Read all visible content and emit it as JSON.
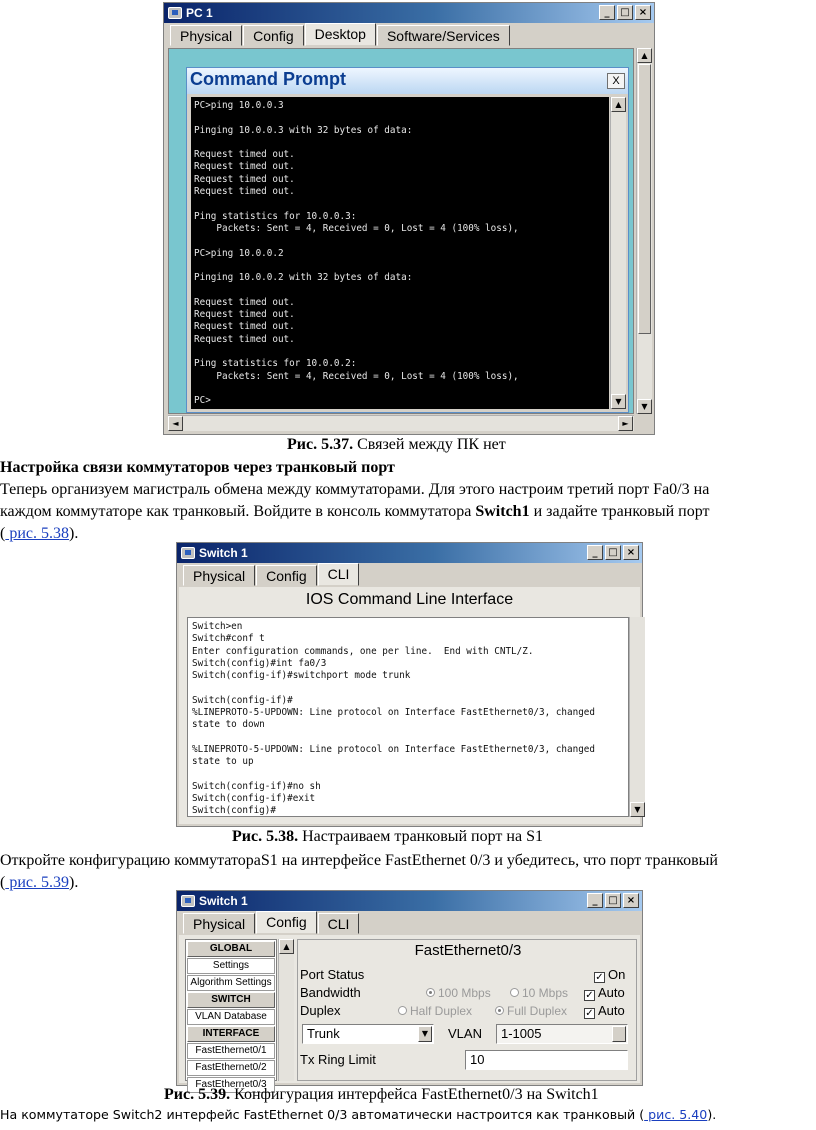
{
  "fig1": {
    "window_title": "PC 1",
    "tabs": [
      "Physical",
      "Config",
      "Desktop",
      "Software/Services"
    ],
    "active_tab": 2,
    "cmd_title": "Command Prompt",
    "cmd_close": "X",
    "console_lines": [
      "PC>ping 10.0.0.3",
      "",
      "Pinging 10.0.0.3 with 32 bytes of data:",
      "",
      "Request timed out.",
      "Request timed out.",
      "Request timed out.",
      "Request timed out.",
      "",
      "Ping statistics for 10.0.0.3:",
      "    Packets: Sent = 4, Received = 0, Lost = 4 (100% loss),",
      "",
      "PC>ping 10.0.0.2",
      "",
      "Pinging 10.0.0.2 with 32 bytes of data:",
      "",
      "Request timed out.",
      "Request timed out.",
      "Request timed out.",
      "Request timed out.",
      "",
      "Ping statistics for 10.0.0.2:",
      "    Packets: Sent = 4, Received = 0, Lost = 4 (100% loss),",
      "",
      "PC>"
    ],
    "caption_num": "Рис. 5.37.",
    "caption_text": " Связей между ПК нет"
  },
  "section": {
    "heading": "Настройка связи коммутаторов через транковый порт",
    "p1_line1": "Теперь организуем магистраль обмена между коммутаторами. Для этого настроим третий порт Fa0/3 на",
    "p1_line2_a": "каждом коммутаторе как транковый. Войдите в консоль коммутатора ",
    "p1_line2_bold": "Switch1",
    "p1_line2_b": " и задайте транковый порт",
    "p1_line3_open": "(",
    "p1_line3_link": " рис. 5.38",
    "p1_line3_close": ")."
  },
  "fig2": {
    "window_title": "Switch 1",
    "tabs": [
      "Physical",
      "Config",
      "CLI"
    ],
    "active_tab": 2,
    "header": "IOS Command Line Interface",
    "cli_lines": [
      "Switch>en",
      "Switch#conf t",
      "Enter configuration commands, one per line.  End with CNTL/Z.",
      "Switch(config)#int fa0/3",
      "Switch(config-if)#switchport mode trunk",
      "",
      "Switch(config-if)#",
      "%LINEPROTO-5-UPDOWN: Line protocol on Interface FastEthernet0/3, changed",
      "state to down",
      "",
      "%LINEPROTO-5-UPDOWN: Line protocol on Interface FastEthernet0/3, changed",
      "state to up",
      "",
      "Switch(config-if)#no sh",
      "Switch(config-if)#exit",
      "Switch(config)#"
    ],
    "caption_num": "Рис. 5.38.",
    "caption_text": " Настраиваем транковый порт на S1"
  },
  "section2": {
    "p2_line1": "Откройте конфигурацию коммутатораS1 на интерфейсе FastEthernet 0/3 и убедитесь, что порт транковый",
    "p2_line2_open": "(",
    "p2_line2_link": " рис. 5.39",
    "p2_line2_close": ")."
  },
  "fig3": {
    "window_title": "Switch 1",
    "tabs": [
      "Physical",
      "Config",
      "CLI"
    ],
    "active_tab": 1,
    "list_items": [
      {
        "label": "GLOBAL",
        "head": true
      },
      {
        "label": "Settings",
        "head": false
      },
      {
        "label": "Algorithm Settings",
        "head": false
      },
      {
        "label": "SWITCH",
        "head": true
      },
      {
        "label": "VLAN Database",
        "head": false
      },
      {
        "label": "INTERFACE",
        "head": true
      },
      {
        "label": "FastEthernet0/1",
        "head": false
      },
      {
        "label": "FastEthernet0/2",
        "head": false
      },
      {
        "label": "FastEthernet0/3",
        "head": false
      }
    ],
    "panel_title": "FastEthernet0/3",
    "port_status_label": "Port Status",
    "on_label": "On",
    "bandwidth_label": "Bandwidth",
    "bw_100": "100 Mbps",
    "bw_10": "10 Mbps",
    "auto_label": "Auto",
    "duplex_label": "Duplex",
    "half_duplex": "Half Duplex",
    "full_duplex": "Full Duplex",
    "mode_value": "Trunk",
    "vlan_label": "VLAN",
    "vlan_value": "1-1005",
    "tx_label": "Tx Ring Limit",
    "tx_value": "10",
    "caption_num": "Рис. 5.39.",
    "caption_text": " Конфигурация интерфейса FastEthernet0/3 на Switch1"
  },
  "footer": {
    "text": "На коммутаторе Switch2 интерфейс FastEthernet 0/3 автоматически настроится как транковый (",
    "link": " рис. 5.40",
    "close": ")."
  }
}
